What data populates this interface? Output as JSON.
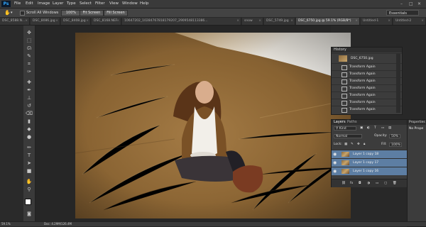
{
  "app": {
    "logo": "Ps"
  },
  "menubar": {
    "items": [
      "File",
      "Edit",
      "Image",
      "Layer",
      "Type",
      "Select",
      "Filter",
      "View",
      "Window",
      "Help"
    ],
    "window_controls": [
      "–",
      "□",
      "✕"
    ]
  },
  "options": {
    "scroll_all_label": "Scroll All Windows",
    "buttons": [
      "100%",
      "Fit Screen",
      "Fill Screen"
    ],
    "workspace": "Essentials"
  },
  "tabs": [
    {
      "label": "DSC_8588.N..."
    },
    {
      "label": "DSC_8086.jpg"
    },
    {
      "label": "DSC_8408.jpg"
    },
    {
      "label": "DSC_8168.NEF"
    },
    {
      "label": "10647202_10284767818179207_2909548113386..."
    },
    {
      "label": "snow"
    },
    {
      "label": "DSC_5749.jpg"
    },
    {
      "label": "DSC_6750.jpg @ 59.1% (RGB/8*)",
      "active": true
    },
    {
      "label": "Untitled-1"
    },
    {
      "label": "Untitled-2"
    }
  ],
  "history": {
    "tabs": [
      "History"
    ],
    "snapshot": "DSC_6750.jpg",
    "items": [
      "Transform Again",
      "Transform Again",
      "Transform Again",
      "Transform Again",
      "Transform Again",
      "Transform Again",
      "Transform Again"
    ]
  },
  "layers": {
    "tabs": [
      "Layers",
      "Paths"
    ],
    "kind_filter": "Kind",
    "blend_mode": "Normal",
    "opacity_label": "Opacity:",
    "opacity": "50%",
    "lock_label": "Lock:",
    "fill_label": "Fill:",
    "fill": "100%",
    "items": [
      "Layer 1 copy 18",
      "Layer 1 copy 17",
      "Layer 1 copy 16"
    ]
  },
  "properties": {
    "title": "Properties",
    "body": "No Prope"
  },
  "status": {
    "zoom": "59.1%",
    "doc": "Doc: 4.29M/126.4M"
  },
  "colors": {
    "accent": "#31a8ff",
    "selection": "#5d7ea3"
  }
}
